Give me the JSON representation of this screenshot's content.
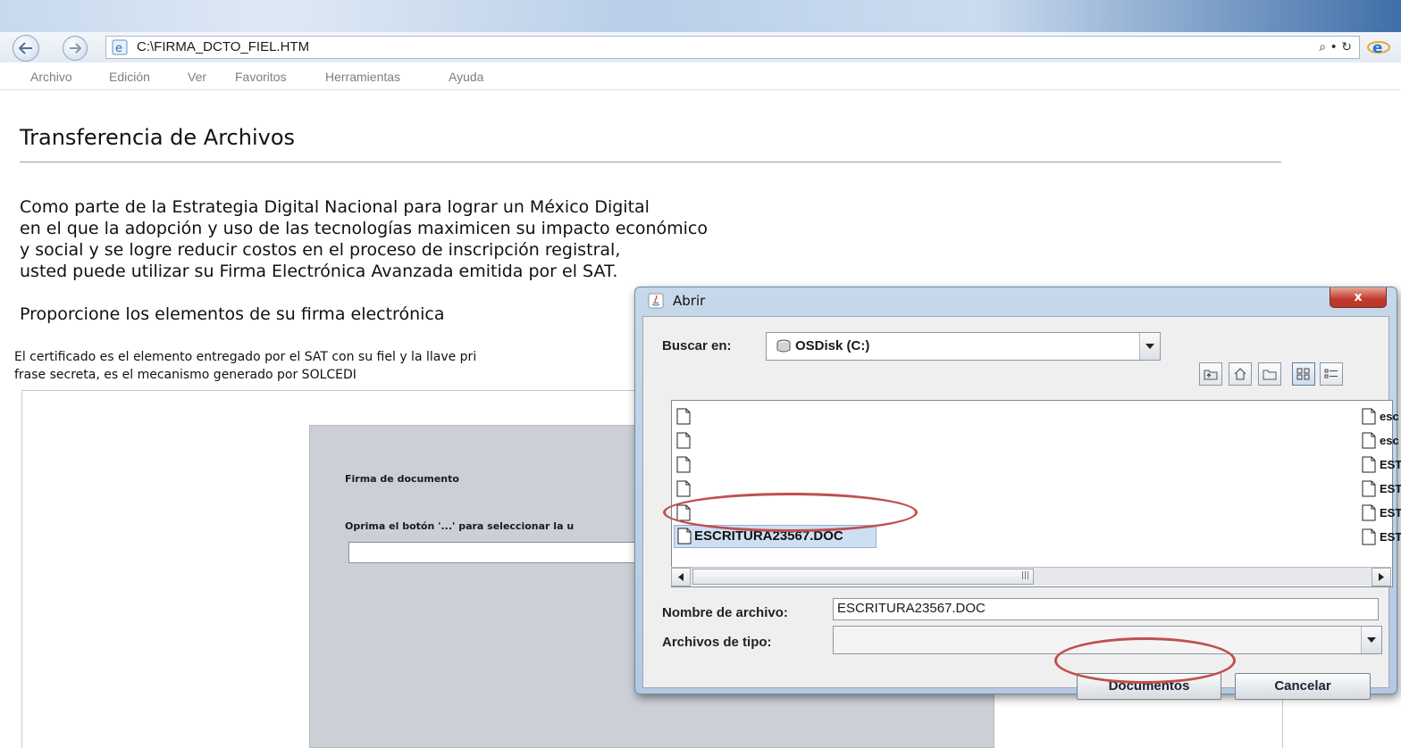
{
  "browser": {
    "url": "C:\\FIRMA_DCTO_FIEL.HTM",
    "address_tools": "⌕ • ↻",
    "menu": [
      "Archivo",
      "Edición",
      "Ver",
      "Favoritos",
      "Herramientas",
      "Ayuda"
    ]
  },
  "page": {
    "title": "Transferencia de Archivos",
    "intro_lines": [
      "Como parte de la Estrategia Digital Nacional para lograr un México Digital",
      "en el que la adopción y uso de las tecnologías maximicen su impacto económico",
      "y social y se logre reducir costos en el proceso de inscripción registral,",
      "usted puede utilizar su Firma Electrónica Avanzada emitida por el SAT."
    ],
    "subheading": "Proporcione los elementos de su firma electrónica",
    "cert_lines": [
      "El certificado es el elemento entregado por el SAT con su fiel y la llave pri",
      "frase secreta, es el mecanismo generado por SOLCEDI"
    ],
    "applet": {
      "title": "Firma de documento",
      "instruction": "Oprima el  botón '...' para seleccionar la u",
      "input_value": ""
    }
  },
  "dialog": {
    "title": "Abrir",
    "close_label": "x",
    "look_in_label": "Buscar en:",
    "look_in_value": "OSDisk (C:)",
    "files_left": [
      "",
      "",
      "",
      "",
      "",
      "ESCRITURA23567.DOC"
    ],
    "files_right": [
      "esc",
      "esc",
      "EST",
      "EST",
      "EST",
      "EST"
    ],
    "filename_label": "Nombre de archivo:",
    "filename_value": "ESCRITURA23567.DOC",
    "filetype_label": "Archivos de tipo:",
    "filetype_value": "",
    "open_button": "Documentos",
    "cancel_button": "Cancelar",
    "annotation_color": "#c0504d"
  }
}
